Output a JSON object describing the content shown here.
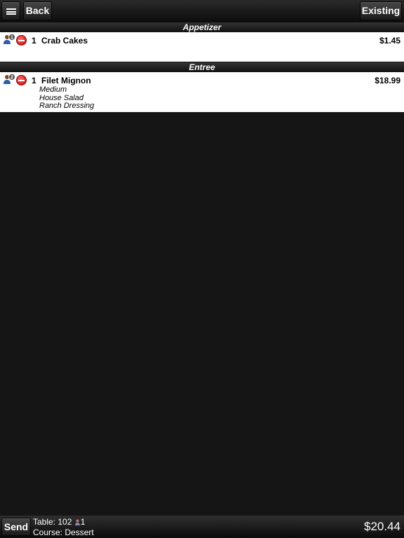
{
  "toolbar": {
    "back_label": "Back",
    "existing_label": "Existing",
    "menu_icon": "hamburger-menu-icon"
  },
  "sections": [
    {
      "header": "Appetizer",
      "items": [
        {
          "seat": "1",
          "qty": "1",
          "name": "Crab Cakes",
          "price": "$1.45",
          "modifiers": []
        }
      ]
    },
    {
      "header": "Entree",
      "items": [
        {
          "seat": "2",
          "qty": "1",
          "name": "Filet Mignon",
          "price": "$18.99",
          "modifiers": [
            "Medium",
            "House Salad",
            "Ranch Dressing"
          ]
        }
      ]
    }
  ],
  "footer": {
    "send_label": "Send",
    "table_text": "Table: 102",
    "guest_count": "1",
    "course_text": "Course: Dessert",
    "total": "$20.44"
  },
  "colors": {
    "background": "#151515",
    "panel": "#ffffff",
    "remove_red": "#c40000"
  }
}
